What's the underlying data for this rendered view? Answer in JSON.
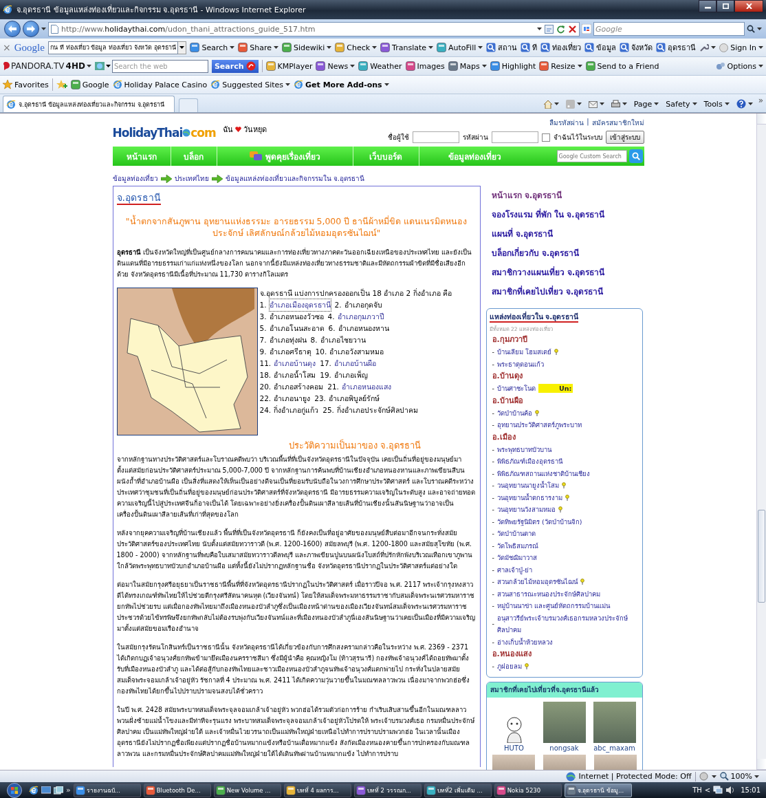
{
  "window": {
    "title": "จ.อุดรธานี ข้อมูลแหล่งท่องเที่ยวและกิจกรรม จ.อุดรธานี - Windows Internet Explorer",
    "address": "http://www.**holidaythai.com**/udon_thani_attractions_guide_517.htm",
    "search_placeholder": "Google"
  },
  "google_toolbar": {
    "close": "×",
    "logo": "Google",
    "query": "กน ที ท่องเที่ยว ข้อมูล ท่องเที่ยว จังหวัด อุดรธานี",
    "buttons": [
      {
        "label": "Search",
        "dropdown": true
      },
      {
        "label": "Share",
        "dropdown": true
      },
      {
        "label": "Sidewiki",
        "dropdown": true
      },
      {
        "label": "Check",
        "dropdown": true
      },
      {
        "label": "Translate",
        "dropdown": true
      },
      {
        "label": "AutoFill",
        "dropdown": true
      }
    ],
    "highlight_words": [
      "สถาน",
      "ที",
      "ท่องเที่ยว",
      "ข้อมูล",
      "จังหวัด",
      "อุดรธานี"
    ],
    "sign_in": "Sign In"
  },
  "pandora_toolbar": {
    "logo": "PANDORA.TV",
    "logo_badge": "4HD",
    "search_placeholder": "Search the web",
    "search_button": "Search",
    "buttons": [
      {
        "label": "KMPlayer",
        "dropdown": false
      },
      {
        "label": "News",
        "dropdown": true
      },
      {
        "label": "Weather",
        "dropdown": false
      },
      {
        "label": "Images",
        "dropdown": false
      },
      {
        "label": "Maps",
        "dropdown": true
      },
      {
        "label": "Highlight",
        "dropdown": false
      },
      {
        "label": "Resize",
        "dropdown": true
      },
      {
        "label": "Send to a Friend",
        "dropdown": false
      }
    ],
    "options": "Options"
  },
  "favorites_bar": {
    "favorites": "Favorites",
    "links": [
      {
        "label": "Google",
        "dropdown": false,
        "bold": false
      },
      {
        "label": "Holiday Palace Casino",
        "dropdown": false,
        "bold": false
      },
      {
        "label": "Suggested Sites",
        "dropdown": true,
        "bold": false
      },
      {
        "label": "Get More Add-ons",
        "dropdown": true,
        "bold": true
      }
    ]
  },
  "tab": {
    "title": "จ.อุดรธานี ข้อมูลแหล่งท่องเที่ยวและกิจกรรม จ.อุดรธานี"
  },
  "command_bar": {
    "menus": [
      "Page",
      "Safety",
      "Tools"
    ],
    "overflow": "»"
  },
  "site_header": {
    "logo_main": "HolidayThai",
    "logo_suffix": "com",
    "tagline_start": "ฉัน",
    "tagline_end": "วันหยุด",
    "account_links": [
      "ลืมรหัสผ่าน",
      "สมัครสมาชิกใหม่"
    ],
    "account_separator": "|",
    "username_label": "ชื่อผู้ใช้",
    "password_label": "รหัสผ่าน",
    "remember": {
      "label": "จำฉันไว้ในระบบ",
      "checked": false
    },
    "login_button": "เข้าสู่ระบบ"
  },
  "nav": {
    "items": [
      "หน้าแรก",
      "บล็อก",
      "พูดคุยเรื่องเที่ยว",
      "เว็บบอร์ด",
      "ข้อมูลท่องเที่ยว"
    ],
    "search_placeholder": "Google Custom Search"
  },
  "breadcrumb": [
    "ข้อมูลท่องเที่ยว",
    "ประเทศไทย",
    "ข้อมูลแหล่งท่องเที่ยวและกิจกรรมใน จ.อุดรธานี"
  ],
  "article": {
    "heading": "จ.อุดรธานี",
    "slogan": "\"น้ำตกจากสันภูพาน อุทยานแห่งธรรมะ อารยธรรม 5,000 ปี ธานีผ้าหมี่ขิด แดนเนรมิตหนองประจักษ์ เลิศลักษณ์กล้วยไม้หอมอุดรซันไฌน์\"",
    "intro": "**อุดรธานี** เป็นจังหวัดใหญ่ที่เป็นศูนย์กลางการคมนาคมและการท่องเที่ยวทางภาคตะวันออกเฉียงเหนือของประเทศไทย และยังเป็นดินแดนที่มีอารยธรรมเก่าแก่แห่งหนึ่งของโลก นอกจากนี้ยังมีแหล่งท่องเที่ยวทางธรรมชาติและมีหัตถกรรมผ้าขิดที่มีชื่อเสียงอีกด้วย จังหวัดอุดรธานีมีเนื้อที่ประมาณ 11,730 ตารางกิโลเมตร",
    "districts_intro": "จ.อุดรธานี แบ่งการปกครองออกเป็น 18 อำเภอ 2 กิ่งอำเภอ คือ",
    "districts": [
      [
        {
          "number": "1.",
          "name": "อำเภอเมืองอุดรธานี",
          "link": true,
          "focused": true
        },
        {
          "number": "2.",
          "name": "อำเภอกุดจับ",
          "link": false,
          "focused": false
        }
      ],
      [
        {
          "number": "3.",
          "name": "อำเภอหนองวัวซอ",
          "link": false,
          "focused": false
        },
        {
          "number": "4.",
          "name": "อำเภอกุมภวาปี",
          "link": true,
          "focused": false
        }
      ],
      [
        {
          "number": "5.",
          "name": "อำเภอโนนสะอาด",
          "link": false,
          "focused": false
        },
        {
          "number": "6.",
          "name": "อำเภอหนองหาน",
          "link": false,
          "focused": false
        }
      ],
      [
        {
          "number": "7.",
          "name": "อำเภอทุ่งฝน",
          "link": false,
          "focused": false
        },
        {
          "number": "8.",
          "name": "อำเภอไชยวาน",
          "link": false,
          "focused": false
        }
      ],
      [
        {
          "number": "9.",
          "name": "อำเภอศรีธาตุ",
          "link": false,
          "focused": false
        },
        {
          "number": "10.",
          "name": "อำเภอวังสามหมอ",
          "link": false,
          "focused": false
        }
      ],
      [
        {
          "number": "11.",
          "name": "อำเภอบ้านดุง",
          "link": true,
          "focused": false
        },
        {
          "number": "17.",
          "name": "อำเภอบ้านผือ",
          "link": true,
          "focused": false
        }
      ],
      [
        {
          "number": "18.",
          "name": "อำเภอน้ำโสม",
          "link": false,
          "focused": false
        },
        {
          "number": "19.",
          "name": "อำเภอเพ็ญ",
          "link": false,
          "focused": false
        }
      ],
      [
        {
          "number": "20.",
          "name": "อำเภอสร้างคอม",
          "link": false,
          "focused": false
        },
        {
          "number": "21.",
          "name": "อำเภอหนองแสง",
          "link": true,
          "focused": false
        }
      ],
      [
        {
          "number": "22.",
          "name": "อำเภอนายูง",
          "link": false,
          "focused": false
        },
        {
          "number": "23.",
          "name": "อำเภอพิบูลย์รักษ์",
          "link": false,
          "focused": false
        }
      ],
      [
        {
          "number": "24.",
          "name": "กิ่งอำเภอกู่แก้ว",
          "link": false,
          "focused": false
        },
        {
          "number": "25.",
          "name": "กิ่งอำเภอประจักษ์ศิลปาคม",
          "link": false,
          "focused": false
        }
      ]
    ],
    "history_heading": "ประวัติความเป็นมาของ จ.อุดรธานี",
    "history": [
      "จากหลักฐานทางประวัติศาสตร์และโบราณคดีพบว่า บริเวณพื้นที่ที่เป็นจังหวัดอุดรธานีในปัจจุบัน เคยเป็นถิ่นที่อยู่ของมนุษย์มาตั้งแต่สมัยก่อนประวัติศาสตร์ประมาณ 5,000-7,000 ปี จากหลักฐานการค้นพบที่บ้านเชียงอำเภอหนองหานและภาพเขียนสีบนผนังถ้ำที่อำเภอบ้านผือ เป็นสิ่งที่แสดงให้เห็นเป็นอย่างดีจนเป็นที่ยอมรับนับถือในวงการศึกษาประวัติศาสตร์ และโบราณคดีระหว่างประเทศว่าชุมชนที่เป็นถิ่นที่อยู่ของมนุษย์ก่อนประวัติศาสตร์ที่จังหวัดอุดรธานี มีอารยธรรมความเจริญในระดับสูง และอาจถ่ายทอดความเจริญนี้ไปสู่ประเทศจีนก็อาจเป็นได้ โดยเฉพาะอย่างยิ่งเครื่องปั้นดินเผาสีลายเส้นที่บ้านเชียงนั้นสันนิษฐานว่าอาจเป็นเครื่องปั้นดินเผาสีลายเส้นที่เก่าที่สุดของโลก",
      "หลังจากยุคความเจริญที่บ้านเชียงแล้ว พื้นที่ที่เป็นจังหวัดอุดรธานี ก็ยังคงเป็นที่อยู่อาศัยของมนุษย์สืบต่อมาอีกจนกระทั่งสมัยประวัติศาสตร์ของประเทศไทย นับตั้งแต่สมัยทวาราวดี (พ.ศ. 1200-1600) สมัยลพบุรี (พ.ศ. 1200-1800 และสมัยสุโขทัย (พ.ศ. 1800 - 2000) จากหลักฐานที่พบคือใบเสมาสมัยทวาราวดีลพบุรี และภาพเขียนปูนบนผนังโบสถ์ที่ปรักหักพังบริเวณเทือกเขาภูพานใกล้วัดพระพุทธบาทบัวบกอำเภอบ้านผือ แต่ทั้งนี้ยังไม่ปรากฏหลักฐานชื่อ จังหวัดอุดรธานีปรากฏในประวัติศาสตร์แต่อย่างใด",
      "ต่อมาในสมัยกรุงศรีอยุธยาเป็นราชธานีพื้นที่ที่จังหวัดอุดรธานีปรากฏในประวัติศาสตร์ เมื่อราวปีจอ พ.ศ. 2117 พระเจ้ากรุงหงสาวดีได้ทรงเกณฑ์ทัพไทยให้ไปช่วยตีกรุงศรีสัตนาคนหุต (เวียงจันทน์) โดยให้สมเด็จพระมหาธรรมราชากับสมเด็จพระนเรศวรมหาราชยกทัพไปช่วยรบ แต่เมื่อกองทัพไทยมาถึงเมืองหนองบัวลำภูซึ่งเป็นเมืองหน้าด่านของเมืองเวียงจันทน์สมเด็จพระนเรศวรมหาราชประชวรด้วยไข้ทรพิษจึงยกทัพกลับไม่ต้องรบพุ่งกับเวียงจันทน์และที่เมืองหนองบัวลำภูนี่เองสันนิษฐานว่าเคยเป็นเมืองที่มีความเจริญมาตั้งแต่สมัยขอมเรืองอำนาจ",
      "ในสมัยกรุงรัตนโกสินทร์เป็นราชธานีนั้น จังหวัดอุดรธานีได้เกี่ยวข้องกับการศึกสงครามกล่าวคือในระหว่าง พ.ศ. 2369 - 2371 ได้เกิดกบฏเจ้าอนุวงศ์ยกทัพเข้ามายึดเมืองนครราชสีมา ซึ่งมีผู้นำคือ คุณหญิงโม (ท้าวสุรนารี) กองทัพเจ้าอนุวงศ์ได้ถอยทัพมาตั้งรับที่เมืองหนองบัวลำภู และได้ต่อสู้กับกองทัพไทยและชาวเมืองหนองบัวลำภูจนทัพเจ้าอนุวงศ์แตกพ่ายไป กระทั่งในปลายสมัยสมเด็จพระจอมเกล้าเจ้าอยู่หัว รัชกาลที่ 4 ประมาณ พ.ศ. 2411 ได้เกิดความวุ่นวายขึ้นในมณฑลลาวพวน เนื่องมาจากพวกฮ่อซึ่งกองทัพไทยได้ยกขึ้นไปปราบปรามจนสงบได้ชั่วคราว",
      "ในปี พ.ศ. 2428 สมัยพระบาทสมเด็จพระจุลจอมเกล้าเจ้าอยู่หัว พวกฮ่อได้รวมตัวก่อการร้าย กำเริบเสิบสานขึ้นอีกในมณฑลลาวพวนฝั่งซ้ายแม่น้ำโขงและมีท่าทีจะรุนแรง พระบาทสมเด็จพระจุลจอมเกล้าเจ้าอยู่หัวโปรดให้ พระเจ้าบรมวงศ์เธอ กรมหมื่นประจักษ์ศิลปาคม เป็นแม่ทัพใหญ่ฝ่ายใต้ และเจ้าหมื่นไวยวรนาถเป็นแม่ทัพใหญ่ฝ่ายเหนือไปทำการปราบปรามพวกฮ่อ ในเวลานั้นเมืองอุดรธานียังไม่ปรากฏชื่อเพียงแต่ปรากฏชื่อบ้านหมากแข้งหรือบ้านเดื่อหมากแข้ง สังกัดเมืองหนองคายขึ้นการปกครองกับมณฑลลาวพวน และกรมหมื่นประจักษ์ศิลปาคมแม่ทัพใหญ่ฝ่ายใต้ได้เดินทัพผ่านบ้านหมากแข้ง ไปทำการปราบ"
    ]
  },
  "sidebar": {
    "links": [
      "หน้าแรก จ.อุดรธานี",
      "จองโรงแรม ที่พัก ใน จ.อุดรธานี",
      "แผนที่ จ.อุดรธานี",
      "บล็อกเกี่ยวกับ จ.อุดรธานี",
      "สมาชิกวางแผนเที่ยว จ.อุดรธานี",
      "สมาชิกที่เคยไปเที่ยว จ.อุดรธานี"
    ],
    "attractions": {
      "title": "แหล่งท่องเที่ยวใน จ.อุดรธานี",
      "count": "มีทั้งหมด 22 แหล่งท่องเที่ยว",
      "groups": [
        {
          "district": "อ.กุมภวาปี",
          "places": [
            {
              "bullet": "-",
              "name": "บ้านเลียม โฮมสเตย์",
              "marker": true
            },
            {
              "bullet": "-",
              "name": "พระธาตุดอนแก้ว",
              "marker": false
            }
          ]
        },
        {
          "district": "อ.บ้านดุง",
          "places": [
            {
              "bullet": "-",
              "name": "บ้านศาชะโนด",
              "marker": false,
              "badge": "Un:"
            }
          ]
        },
        {
          "district": "อ.บ้านผือ",
          "places": [
            {
              "bullet": "-",
              "name": "วัดป่าบ้านค้อ",
              "marker": true
            },
            {
              "bullet": "-",
              "name": "อุทยานประวัติศาสตร์ภูพระบาท",
              "marker": false
            }
          ]
        },
        {
          "district": "อ.เมือง",
          "places": [
            {
              "bullet": "-",
              "name": "พระพุทธบาทบัวบาน",
              "marker": false
            },
            {
              "bullet": "-",
              "name": "พิพิธภัณฑ์เมืองอุดรธานี",
              "marker": false
            },
            {
              "bullet": "-",
              "name": "พิพิธภัณฑสถานแห่งชาติบ้านเชียง",
              "marker": false
            },
            {
              "bullet": "-",
              "name": "วนอุทยานนายูงน้ำโสม",
              "marker": true
            },
            {
              "bullet": "-",
              "name": "วนอุทยานน้ำตกธารงาม",
              "marker": true
            },
            {
              "bullet": "-",
              "name": "วนอุทยานวังสามหมอ",
              "marker": true
            },
            {
              "bullet": "-",
              "name": "วัดทิพยรัฐนิมิตร (วัดป่าบ้านจิก)",
              "marker": false
            },
            {
              "bullet": "-",
              "name": "วัดป่าบ้านตาด",
              "marker": false
            },
            {
              "bullet": "-",
              "name": "วัดโพธิสมภรณ์",
              "marker": false
            },
            {
              "bullet": "-",
              "name": "วัดมัชฌิมาวาส",
              "marker": false
            },
            {
              "bullet": "-",
              "name": "ศาลเจ้าปู่-ย่า",
              "marker": false
            },
            {
              "bullet": "-",
              "name": "สวนกล้วยไม้หอมอุดรซันไฌน์",
              "marker": true
            },
            {
              "bullet": "-",
              "name": "สวนสาธารณะหนองประจักษ์ศิลปาคม",
              "marker": false
            },
            {
              "bullet": "-",
              "name": "หมู่บ้านนาข่า และศูนย์หัตถกรรมบ้านแม่น",
              "marker": false
            },
            {
              "bullet": "-",
              "name": "อนุสาวรีย์พระเจ้าบรมวงศ์เธอกรมหลวงประจักษ์ ศิลปาคม",
              "marker": false
            },
            {
              "bullet": "-",
              "name": "อ่างเก็บน้ำห้วยหลวง",
              "marker": false
            }
          ]
        },
        {
          "district": "อ.หนองแสง",
          "places": [
            {
              "bullet": "-",
              "name": "ภูฝอยลม",
              "marker": true
            }
          ]
        }
      ]
    },
    "members": {
      "title": "สมาชิกที่เคยไปเที่ยวที่จ.อุดรธานีแล้ว",
      "people": [
        {
          "name": "HUTO",
          "kind": "cartoon"
        },
        {
          "name": "nongsak",
          "kind": "photo"
        },
        {
          "name": "abc_maxam",
          "kind": "photo"
        }
      ]
    }
  },
  "status_bar": {
    "zone": "Internet | Protected Mode: Off",
    "zoom": "100%"
  },
  "taskbar": {
    "overflow": "»",
    "tasks": [
      {
        "label": "รายงานฉบั...",
        "selected": false
      },
      {
        "label": "Bluetooth De...",
        "selected": false
      },
      {
        "label": "New Volume ...",
        "selected": false
      },
      {
        "label": "บทที่ 4 ผลการ...",
        "selected": false
      },
      {
        "label": "บทที่ 2 วรรณก...",
        "selected": false
      },
      {
        "label": "บทที่2 เพิ่มเติม ...",
        "selected": false
      },
      {
        "label": "Nokia 5230",
        "selected": false
      },
      {
        "label": "จ.อุดรธานี ข้อมู...",
        "selected": true
      }
    ],
    "language": "TH",
    "tray_expand": "<",
    "clock": "15:01"
  }
}
